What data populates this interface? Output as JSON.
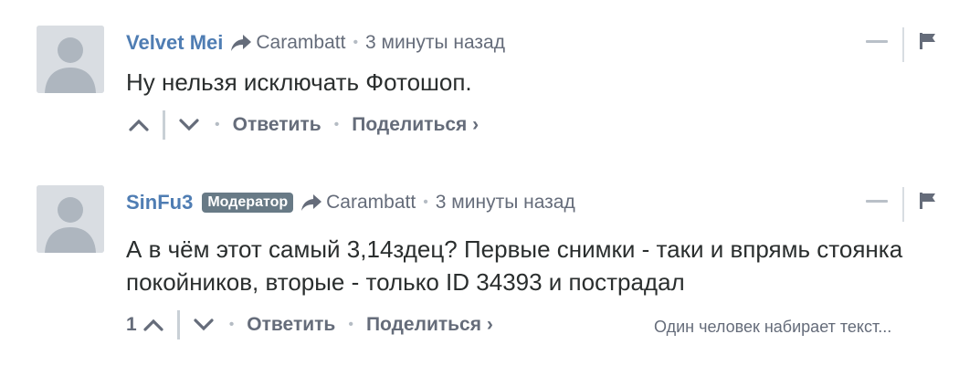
{
  "colors": {
    "author": "#4f7db3",
    "meta": "#656c7a",
    "badge_bg": "#687a86",
    "avatar_bg": "#d9dde2"
  },
  "comments": [
    {
      "author": "Velvet Mei",
      "badge": "",
      "reply_to": "Carambatt",
      "time": "3 минуты назад",
      "text": "Ну нельзя исключать Фотошоп.",
      "votes": "",
      "reply_label": "Ответить",
      "share_label": "Поделиться ›"
    },
    {
      "author": "SinFu3",
      "badge": "Модератор",
      "reply_to": "Carambatt",
      "time": "3 минуты назад",
      "text": "А в чём этот самый 3,14здец? Первые снимки - таки и впрямь стоянка покойников, вторые - только ID 34393 и пострадал",
      "votes": "1",
      "reply_label": "Ответить",
      "share_label": "Поделиться ›"
    }
  ],
  "typing_indicator": "Один человек набирает текст..."
}
